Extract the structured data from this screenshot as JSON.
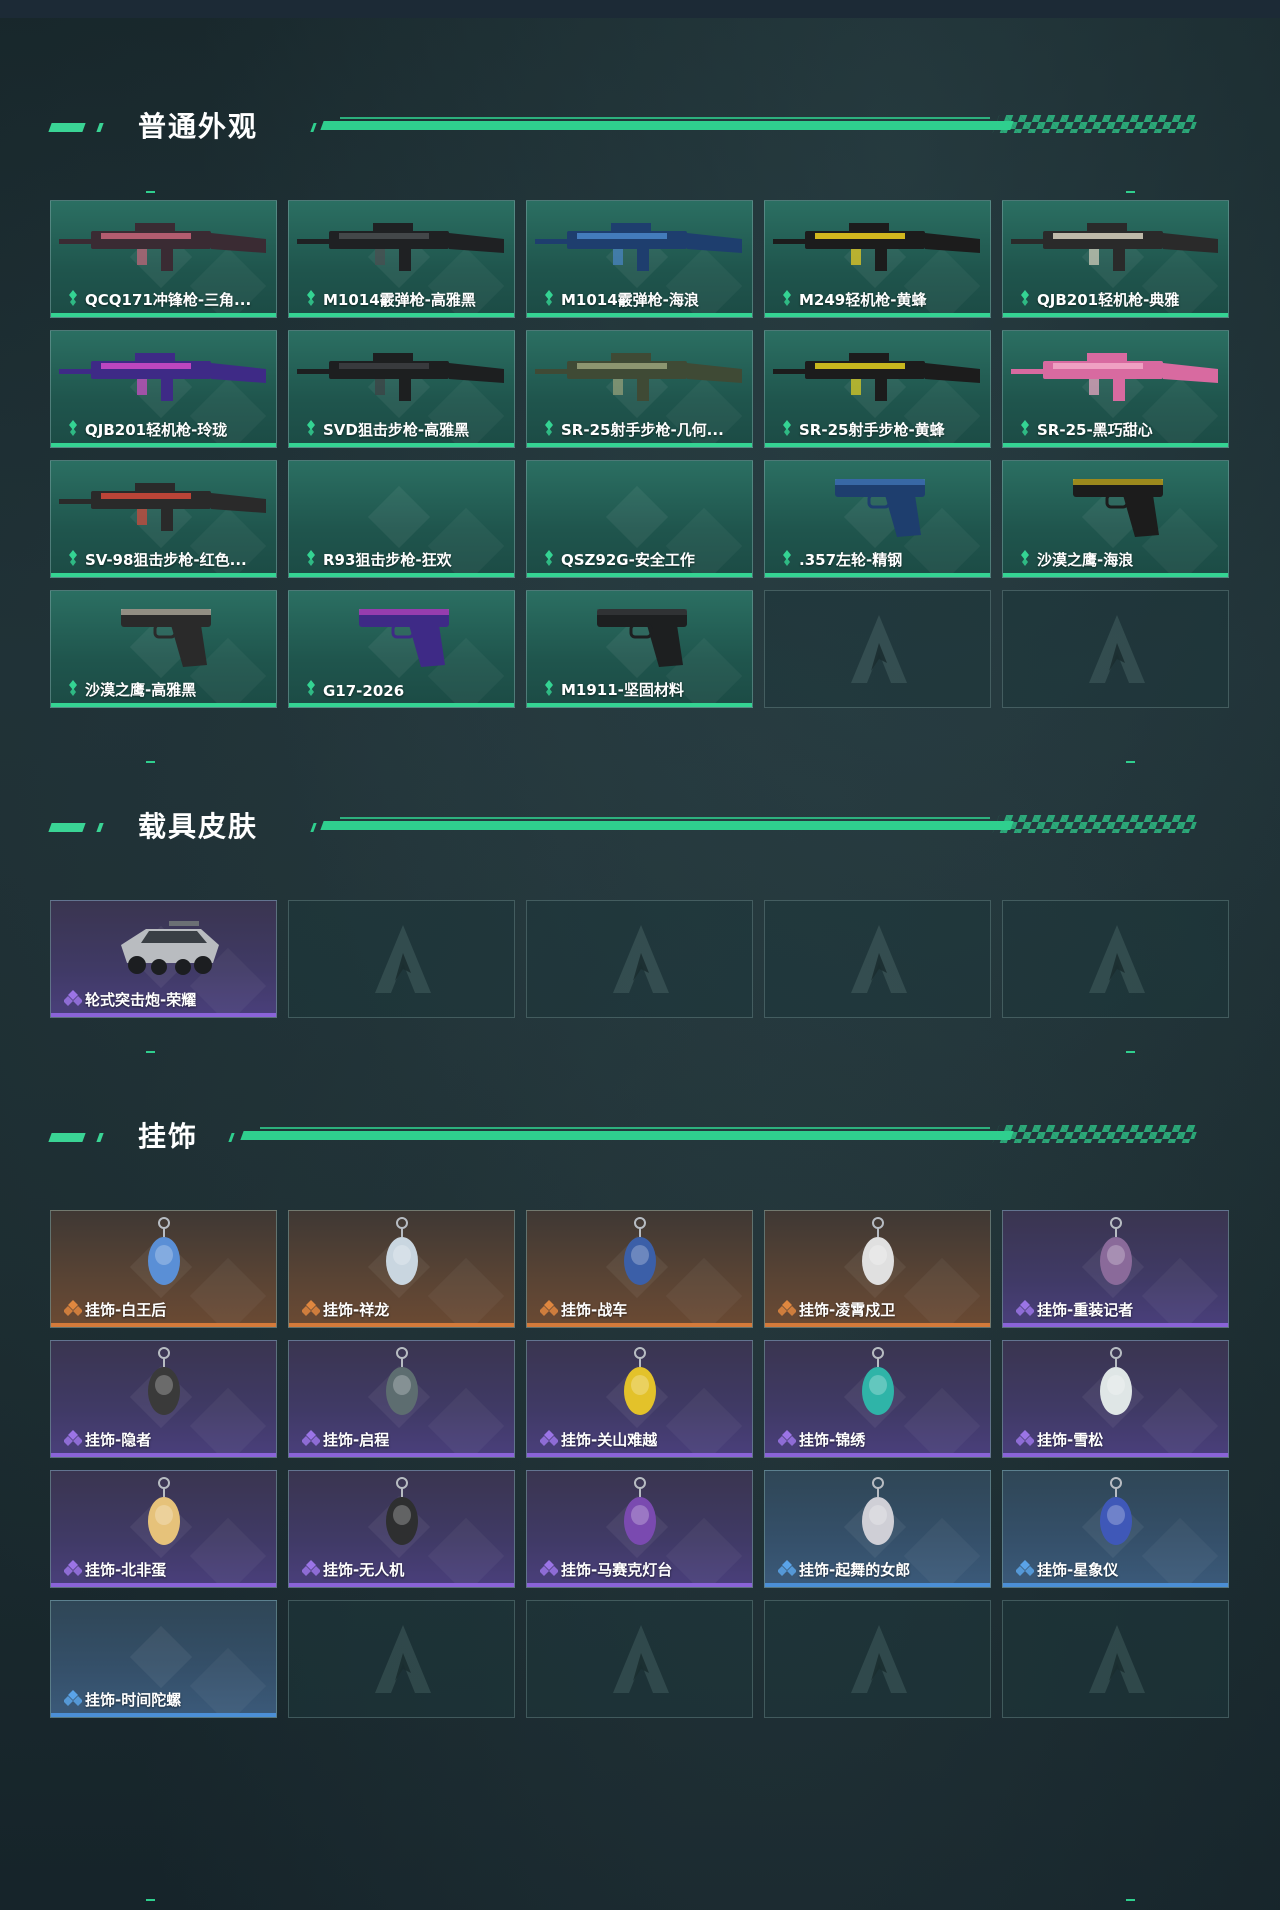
{
  "sections": [
    {
      "title": "普通外观",
      "items": [
        {
          "label": "QCQ171冲锋枪-三角...",
          "rarity": "green",
          "icon": "smg-icon"
        },
        {
          "label": "M1014霰弹枪-高雅黑",
          "rarity": "green",
          "icon": "shotgun-icon"
        },
        {
          "label": "M1014霰弹枪-海浪",
          "rarity": "green",
          "icon": "shotgun-icon"
        },
        {
          "label": "M249轻机枪-黄蜂",
          "rarity": "green",
          "icon": "lmg-icon"
        },
        {
          "label": "QJB201轻机枪-典雅",
          "rarity": "green",
          "icon": "lmg-icon"
        },
        {
          "label": "QJB201轻机枪-玲珑",
          "rarity": "green",
          "icon": "lmg-icon"
        },
        {
          "label": "SVD狙击步枪-高雅黑",
          "rarity": "green",
          "icon": "sniper-rifle-icon"
        },
        {
          "label": "SR-25射手步枪-几何...",
          "rarity": "green",
          "icon": "rifle-icon"
        },
        {
          "label": "SR-25射手步枪-黄蜂",
          "rarity": "green",
          "icon": "rifle-icon"
        },
        {
          "label": "SR-25-黑巧甜心",
          "rarity": "green",
          "icon": "rifle-icon"
        },
        {
          "label": "SV-98狙击步枪-红色...",
          "rarity": "green",
          "icon": "sniper-rifle-icon"
        },
        {
          "label": "R93狙击步枪-狂欢",
          "rarity": "green",
          "icon": ""
        },
        {
          "label": "QSZ92G-安全工作",
          "rarity": "green",
          "icon": ""
        },
        {
          "label": ".357左轮-精钢",
          "rarity": "green",
          "icon": "revolver-icon"
        },
        {
          "label": "沙漠之鹰-海浪",
          "rarity": "green",
          "icon": "pistol-icon"
        },
        {
          "label": "沙漠之鹰-高雅黑",
          "rarity": "green",
          "icon": "pistol-icon"
        },
        {
          "label": "G17-2026",
          "rarity": "green",
          "icon": "pistol-icon"
        },
        {
          "label": "M1911-坚固材料",
          "rarity": "green",
          "icon": "pistol-icon"
        },
        {
          "label": "",
          "rarity": "empty",
          "icon": "logo-icon"
        },
        {
          "label": "",
          "rarity": "empty",
          "icon": "logo-icon"
        }
      ]
    },
    {
      "title": "载具皮肤",
      "items": [
        {
          "label": "轮式突击炮-荣耀",
          "rarity": "purple",
          "icon": "vehicle-icon"
        },
        {
          "label": "",
          "rarity": "empty",
          "icon": "logo-icon"
        },
        {
          "label": "",
          "rarity": "empty",
          "icon": "logo-icon"
        },
        {
          "label": "",
          "rarity": "empty",
          "icon": "logo-icon"
        },
        {
          "label": "",
          "rarity": "empty",
          "icon": "logo-icon"
        }
      ]
    },
    {
      "title": "挂饰",
      "items": [
        {
          "label": "挂饰-白王后",
          "rarity": "orange",
          "icon": "charm-icon"
        },
        {
          "label": "挂饰-祥龙",
          "rarity": "orange",
          "icon": "charm-icon"
        },
        {
          "label": "挂饰-战车",
          "rarity": "orange",
          "icon": "charm-icon"
        },
        {
          "label": "挂饰-凌霄戍卫",
          "rarity": "orange",
          "icon": "charm-icon"
        },
        {
          "label": "挂饰-重装记者",
          "rarity": "purple",
          "icon": "charm-icon"
        },
        {
          "label": "挂饰-隐者",
          "rarity": "purple",
          "icon": "charm-icon"
        },
        {
          "label": "挂饰-启程",
          "rarity": "purple",
          "icon": "charm-icon"
        },
        {
          "label": "挂饰-关山难越",
          "rarity": "purple",
          "icon": "charm-icon"
        },
        {
          "label": "挂饰-锦绣",
          "rarity": "purple",
          "icon": "charm-icon"
        },
        {
          "label": "挂饰-雪松",
          "rarity": "purple",
          "icon": "charm-icon"
        },
        {
          "label": "挂饰-北非蛋",
          "rarity": "purple",
          "icon": "charm-icon"
        },
        {
          "label": "挂饰-无人机",
          "rarity": "purple",
          "icon": "charm-icon"
        },
        {
          "label": "挂饰-马赛克灯台",
          "rarity": "purple",
          "icon": "charm-icon"
        },
        {
          "label": "挂饰-起舞的女郎",
          "rarity": "blue",
          "icon": "charm-icon"
        },
        {
          "label": "挂饰-星象仪",
          "rarity": "blue",
          "icon": "charm-icon"
        },
        {
          "label": "挂饰-时间陀螺",
          "rarity": "blue",
          "icon": ""
        },
        {
          "label": "",
          "rarity": "empty",
          "icon": "logo-icon"
        },
        {
          "label": "",
          "rarity": "empty",
          "icon": "logo-icon"
        },
        {
          "label": "",
          "rarity": "empty",
          "icon": "logo-icon"
        },
        {
          "label": "",
          "rarity": "empty",
          "icon": "logo-icon"
        }
      ]
    }
  ],
  "colors": {
    "accent_green": "#34d493",
    "rarity_purple": "#8a63d8",
    "rarity_orange": "#d47a3a",
    "rarity_blue": "#4b8fd6"
  }
}
